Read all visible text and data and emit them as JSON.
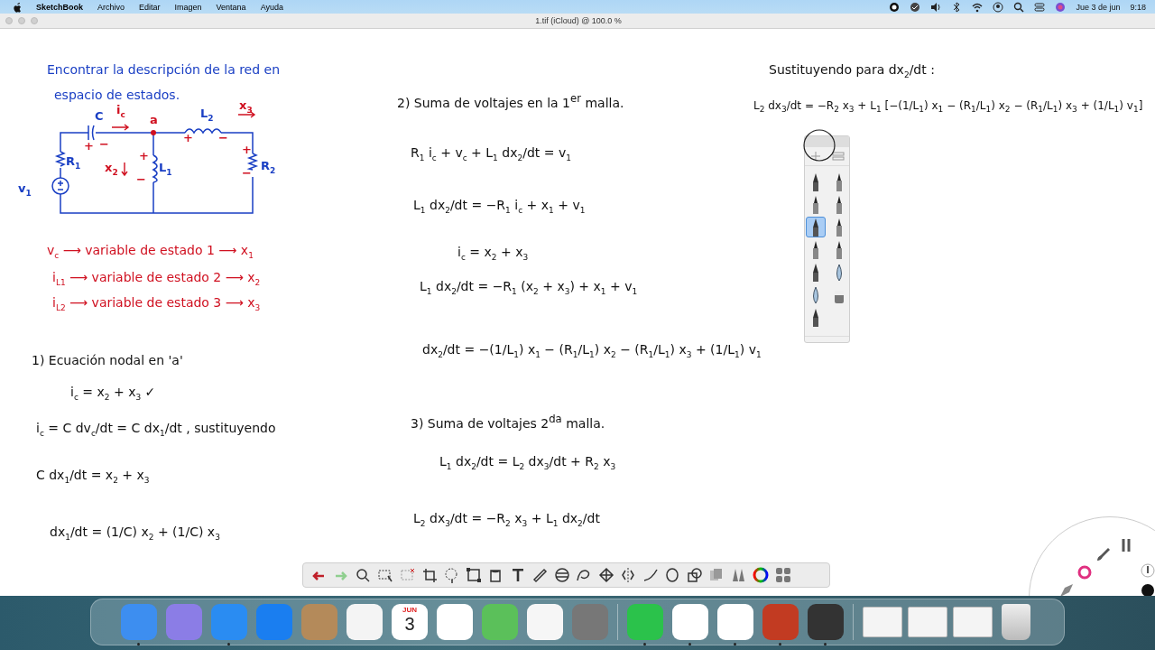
{
  "menu_bar": {
    "app_name": "SketchBook",
    "menus": [
      "Archivo",
      "Editar",
      "Imagen",
      "Ventana",
      "Ayuda"
    ],
    "date": "Jue 3 de jun",
    "time": "9:18"
  },
  "window": {
    "title": "1.tif (iCloud) @ 100.0 %"
  },
  "notes": [
    {
      "text": "Encontrar la descripción de la red en",
      "color": "#1a3fc4"
    },
    {
      "text": "espacio de estados.",
      "color": "#1a3fc4"
    },
    {
      "text": "v$_{c}$ ⟶ variable de estado 1 ⟶ x$_{1}$",
      "color": "#d01020"
    },
    {
      "text": "i$_{L1}$ ⟶ variable de estado 2 ⟶ x$_{2}$",
      "color": "#d01020"
    },
    {
      "text": "i$_{L2}$ ⟶ variable de estado 3 ⟶ x$_{3}$",
      "color": "#d01020"
    },
    {
      "text": "1) Ecuación nodal en 'a'",
      "color": "#111111"
    },
    {
      "text": "i$_{c}$ = x$_{2}$ + x$_{3}$ ✓",
      "color": "#111111"
    },
    {
      "text": "i$_{c}$ = C dv$_{c}$/dt = C dx$_{1}$/dt , sustituyendo",
      "color": "#111111"
    },
    {
      "text": "C dx$_{1}$/dt = x$_{2}$ + x$_{3}$",
      "color": "#111111"
    },
    {
      "text": "dx$_{1}$/dt = (1/C) x$_{2}$ + (1/C) x$_{3}$",
      "color": "#111111"
    },
    {
      "text": "2) Suma de voltajes en la 1$^{er}$ malla.",
      "color": "#111111"
    },
    {
      "text": "R$_{1}$ i$_{c}$ + v$_{c}$ + L$_{1}$ dx$_{2}$/dt = v$_{1}$",
      "color": "#111111"
    },
    {
      "text": "L$_{1}$ dx$_{2}$/dt = −R$_{1}$ i$_{c}$ + x$_{1}$ + v$_{1}$",
      "color": "#111111"
    },
    {
      "text": "i$_{c}$ = x$_{2}$ + x$_{3}$",
      "color": "#111111"
    },
    {
      "text": "L$_{1}$ dx$_{2}$/dt = −R$_{1}$ (x$_{2}$ + x$_{3}$) + x$_{1}$ + v$_{1}$",
      "color": "#111111"
    },
    {
      "text": "dx$_{2}$/dt = −(1/L$_{1}$) x$_{1}$ − (R$_{1}$/L$_{1}$) x$_{2}$ − (R$_{1}$/L$_{1}$) x$_{3}$ + (1/L$_{1}$) v$_{1}$",
      "color": "#111111"
    },
    {
      "text": "3) Suma de voltajes 2$^{da}$ malla.",
      "color": "#111111"
    },
    {
      "text": "L$_{1}$ dx$_{2}$/dt = L$_{2}$ dx$_{3}$/dt + R$_{2}$ x$_{3}$",
      "color": "#111111"
    },
    {
      "text": "L$_{2}$ dx$_{3}$/dt = −R$_{2}$ x$_{3}$ + L$_{1}$ dx$_{2}$/dt",
      "color": "#111111"
    },
    {
      "text": "Sustituyendo para dx$_{2}$/dt :",
      "color": "#111111"
    },
    {
      "text": "L$_{2}$ dx$_{3}$/dt = −R$_{2}$ x$_{3}$ + L$_{1}$ [−(1/L$_{1}$) x$_{1}$ − (R$_{1}$/L$_{1}$) x$_{2}$ − (R$_{1}$/L$_{1}$) x$_{3}$ + (1/L$_{1}$) v$_{1}$]",
      "color": "#111111"
    }
  ],
  "circuit": {
    "labels": [
      {
        "text": "C",
        "color": "#1a3fc4"
      },
      {
        "text": "i$_{c}$",
        "color": "#d01020"
      },
      {
        "text": "a",
        "color": "#d01020"
      },
      {
        "text": "L$_{2}$",
        "color": "#1a3fc4"
      },
      {
        "text": "x$_{3}$",
        "color": "#d01020"
      },
      {
        "text": "R$_{1}$",
        "color": "#1a3fc4"
      },
      {
        "text": "x$_{2}$",
        "color": "#d01020"
      },
      {
        "text": "L$_{1}$",
        "color": "#1a3fc4"
      },
      {
        "text": "R$_{2}$",
        "color": "#1a3fc4"
      },
      {
        "text": "v$_{1}$",
        "color": "#1a3fc4"
      },
      {
        "text": "+",
        "color": "#d01020"
      },
      {
        "text": "−",
        "color": "#d01020"
      },
      {
        "text": "+",
        "color": "#d01020"
      },
      {
        "text": "−",
        "color": "#d01020"
      },
      {
        "text": "+",
        "color": "#d01020"
      },
      {
        "text": "−",
        "color": "#d01020"
      },
      {
        "text": "+",
        "color": "#d01020"
      },
      {
        "text": "−",
        "color": "#d01020"
      }
    ]
  },
  "brush_palette": {
    "brushes": [
      {
        "selected": false
      },
      {
        "selected": false
      },
      {
        "selected": false
      },
      {
        "selected": false
      },
      {
        "selected": true
      },
      {
        "selected": false
      },
      {
        "selected": false
      },
      {
        "selected": false
      },
      {
        "selected": false
      },
      {
        "selected": false
      },
      {
        "selected": false
      },
      {
        "selected": false
      },
      {
        "selected": false
      }
    ]
  },
  "dock": {
    "items": [
      {
        "kind": "app",
        "running": true
      },
      {
        "kind": "app",
        "running": false
      },
      {
        "kind": "app",
        "running": true
      },
      {
        "kind": "app",
        "running": false
      },
      {
        "kind": "app",
        "running": false
      },
      {
        "kind": "app",
        "running": false
      },
      {
        "kind": "calendar",
        "running": false,
        "month": "JUN",
        "day": "3"
      },
      {
        "kind": "app",
        "running": false
      },
      {
        "kind": "app",
        "running": false
      },
      {
        "kind": "app",
        "running": false
      },
      {
        "kind": "app",
        "running": false
      },
      {
        "kind": "separator"
      },
      {
        "kind": "app",
        "running": true
      },
      {
        "kind": "app",
        "running": true
      },
      {
        "kind": "app",
        "running": true
      },
      {
        "kind": "app",
        "running": true
      },
      {
        "kind": "app",
        "running": true
      },
      {
        "kind": "separator"
      },
      {
        "kind": "window",
        "running": false
      },
      {
        "kind": "window",
        "running": false
      },
      {
        "kind": "window",
        "running": false
      },
      {
        "kind": "trash",
        "running": false
      }
    ]
  }
}
